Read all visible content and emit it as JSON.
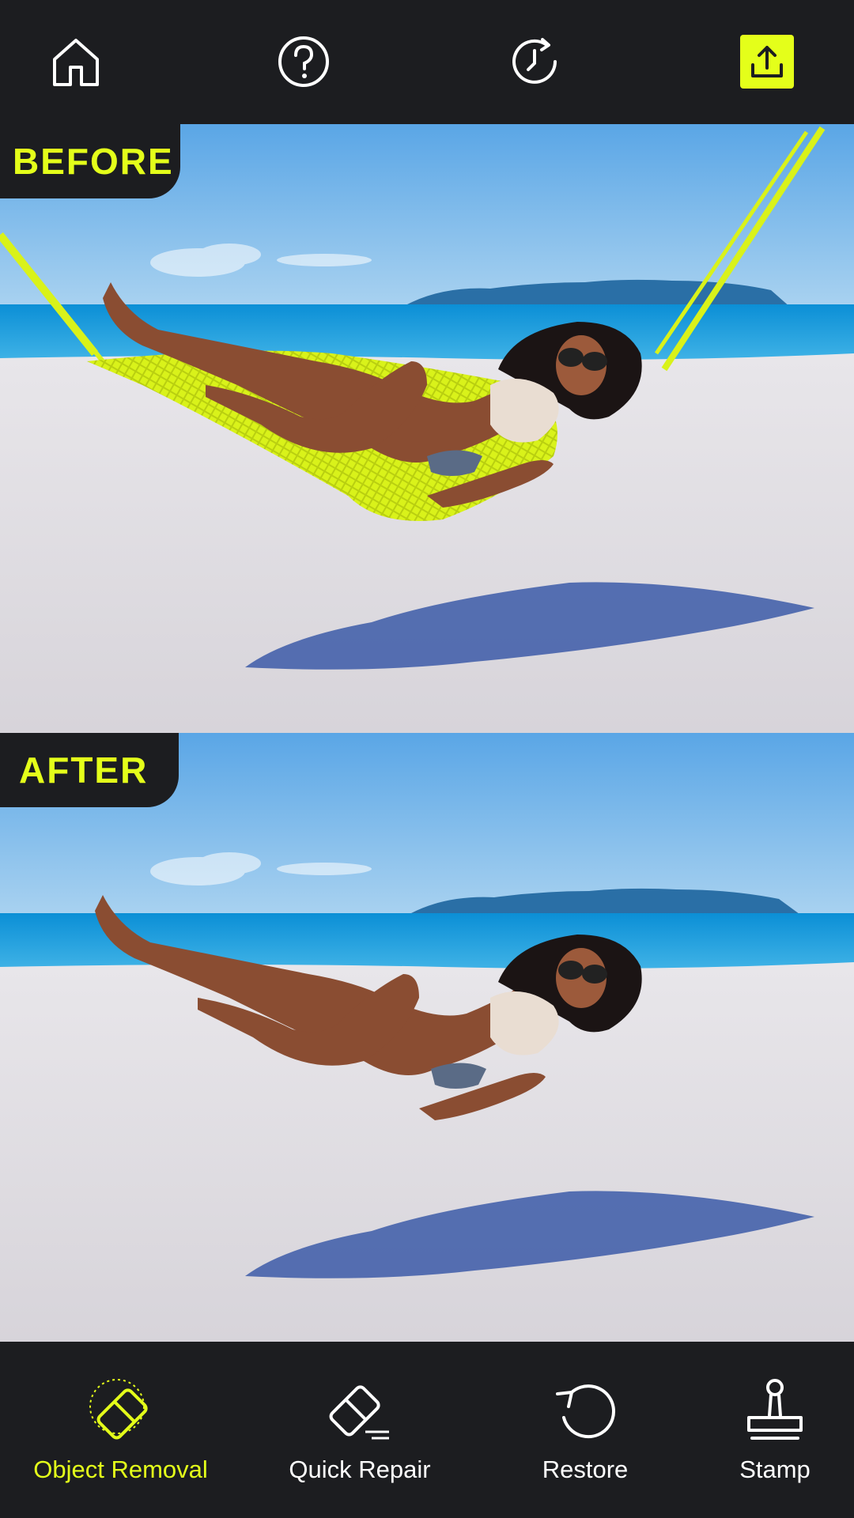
{
  "app": {
    "accent_color": "#e4ff1a",
    "background_color": "#1c1d20"
  },
  "top_toolbar": {
    "buttons": [
      {
        "name": "home",
        "icon": "home-icon"
      },
      {
        "name": "help",
        "icon": "question-circle-icon"
      },
      {
        "name": "history",
        "icon": "history-clock-icon"
      },
      {
        "name": "export",
        "icon": "upload-share-icon",
        "active": true
      }
    ]
  },
  "comparison": {
    "before_label": "BEFORE",
    "after_label": "AFTER"
  },
  "bottom_toolbar": {
    "tools": [
      {
        "label": "Object Removal",
        "icon": "eraser-select-icon",
        "selected": true
      },
      {
        "label": "Quick Repair",
        "icon": "eraser-icon",
        "selected": false
      },
      {
        "label": "Restore",
        "icon": "restore-arrow-icon",
        "selected": false
      },
      {
        "label": "Stamp",
        "icon": "stamp-icon",
        "selected": false
      }
    ]
  }
}
